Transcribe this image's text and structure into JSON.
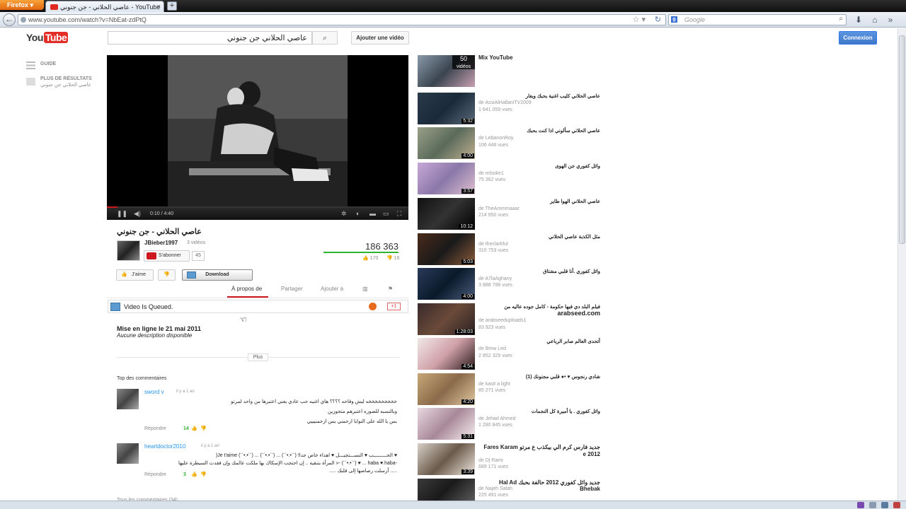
{
  "browser": {
    "app_button": "Firefox",
    "tab_title": "عاصي الحلاني - جن جنوني - YouTube",
    "url": "www.youtube.com/watch?v=NbEat-zdPtQ",
    "search_engine_placeholder": "Google"
  },
  "header": {
    "logo_you": "You",
    "logo_tube": "Tube",
    "search_value": "عاصي الحلاني جن جنوني",
    "upload_label": "Ajouter une vidéo",
    "signin_label": "Connexion"
  },
  "guide": [
    {
      "label": "GUIDE"
    },
    {
      "label": "PLUS DE RÉSULTATS",
      "sub": "عاصي الحلاني جن جنوني"
    }
  ],
  "player": {
    "time_current": "0:10",
    "time_total": "4:40",
    "progress_fraction": 0.036
  },
  "video": {
    "title": "عاصي الحلاني - جن جنوني",
    "uploader": "JBieber1997",
    "video_count": "3 vidéos",
    "subscribe_label": "S'abonner",
    "subscriber_count": "45",
    "views": "186 363",
    "likes": "170",
    "dislikes": "16",
    "like_label": "J'aime",
    "download_label": "Download",
    "tabs": [
      "À propos de",
      "Partager",
      "Ajouter à"
    ],
    "queued_text": "Video Is Queued.",
    "g_plus_label": "+1",
    "published": "Mise en ligne le 21 mai 2011",
    "no_description": "Aucune description disponible",
    "more_label": "Plus"
  },
  "comments": {
    "heading": "Top des commentaires",
    "reply_label": "Répondre",
    "all_label": "Tous les commentaires (34)",
    "items": [
      {
        "author": "sword v",
        "time": "il y a 1 an",
        "text": "خخخخخخخخخه ليش وقاحه ؟؟؟؟ هاي اغنيه حب عادي يعني اعتبرها من واحد لمرتو\nوبالنسبه للصوره اعتبرهم متجوزين\nبس يا الله على النوايا ارحمني يس ارحمنيييي",
        "score": "14"
      },
      {
        "author": "heartdoctor2010",
        "time": "il y a 1 an",
        "text": "♥ الحـــــــــب ♥ النســـتجيـــل ♥ اهداء خاص جدا! (¨`•.•´¨) ... (¨`•.•´¨) ... (¨`•.•´¨) Je t'aime(\n-haba ♥.haba ... ♥ (¨`•.•´¨) -« المرأة بتنقية .. إن احتجت الإسكاك بها ملكت عالمك وإن فقدت السيطرة عليها\n..... أرسلت رصاصها إلى قلبك .....",
        "score": "3"
      }
    ]
  },
  "sidebar": [
    {
      "title": "Mix YouTube",
      "from": "",
      "views": "",
      "duration": "",
      "badge_count": "50",
      "badge_label": "vidéos"
    },
    {
      "title": "عاصي الحلاني كليب اغنية بحبك وبغار",
      "from": "de AssiAlHallaniTV2009",
      "views": "1 641 059 vues",
      "duration": "5:32"
    },
    {
      "title": "عاصي الحلاني سألوني اذا كنت بحبك",
      "from": "de LebanonRoy",
      "views": "106 448 vues",
      "duration": "4:00"
    },
    {
      "title": "وائل كفوري جن الهوى",
      "from": "de mlsoke1",
      "views": "75 362 vues",
      "duration": "3:57"
    },
    {
      "title": "عاصي الحلاني الهوا طاير",
      "from": "de TheAmmmaaar",
      "views": "214 950 vues",
      "duration": "10:12"
    },
    {
      "title": "مثل الكذبة عاصي الحلاني",
      "from": "de theclarkful",
      "views": "310 753 vues",
      "duration": "5:03"
    },
    {
      "title": "وائل كفوري .أنا قلبي مشتاق",
      "from": "de A7laAghany",
      "views": "3 888 788 vues",
      "duration": "4:00"
    },
    {
      "title": "فيلم البلد دي فيها حكومة - كامل جوده عاليه من",
      "title2": "arabseed.com",
      "from": "de arabseeduploads1",
      "views": "83 923 vues",
      "duration": "1:28:03"
    },
    {
      "title": "أتحدى العالم صابر الرباعي",
      "from": "de Bmw Led",
      "views": "2 852 329 vues",
      "duration": "4:54"
    },
    {
      "title": "شادي رنجوس ♥ •● قلبي مجنونك (1)",
      "from": "de kasit a light",
      "views": "85 271 vues",
      "duration": "4:20"
    },
    {
      "title": "وائل كفوري . يا أميرة كل النجمات",
      "from": "de Jehad Ahmed",
      "views": "1 280 845 vues",
      "duration": "5:31"
    },
    {
      "title": "جديد فارس كرم الي بيكذب ع مرتو Fares Karam",
      "title2": "2012 e",
      "from": "de Dj Rami",
      "views": "689 171 vues",
      "duration": "3:39"
    },
    {
      "title": "جديد وائل كفوري 2012 حالفة بحبك Hal Ad Bhebak",
      "from": "de Najeh Salah",
      "views": "225 491 vues",
      "duration": ""
    }
  ]
}
